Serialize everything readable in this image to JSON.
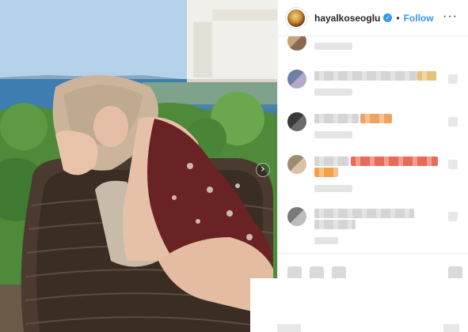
{
  "post": {
    "username": "hayalkoseoglu",
    "verified_glyph": "✓",
    "separator": "•",
    "follow_label": "Follow",
    "more_glyph": "···",
    "next_glyph": "›"
  },
  "colors": {
    "follow_blue": "#3897f0",
    "text_dark": "#262626",
    "border": "#efefef"
  },
  "comments": [
    {
      "avatar_colors": [
        "#c9a27e",
        "#8a6b52"
      ],
      "text_colors": [
        "#d0d0d0"
      ],
      "emoji_colors": []
    },
    {
      "avatar_colors": [
        "#6e7fa8",
        "#b5a9c8"
      ],
      "text_colors": [
        "#cfcfcf"
      ],
      "emoji_colors": [
        "#d9c9e8",
        "#e6c27a"
      ]
    },
    {
      "avatar_colors": [
        "#3a3a3a",
        "#6b6b6b"
      ],
      "text_colors": [
        "#cfcfcf"
      ],
      "emoji_colors": [
        "#f0a35e",
        "#e8c9a0"
      ]
    },
    {
      "avatar_colors": [
        "#a08a72",
        "#d9c2a5"
      ],
      "text_colors": [
        "#cfcfcf"
      ],
      "emoji_colors": [
        "#f4a04a",
        "#e86a5a",
        "#d94b4b"
      ]
    },
    {
      "avatar_colors": [
        "#7a7a7a",
        "#bdbdbd"
      ],
      "text_colors": [
        "#cfcfcf"
      ],
      "emoji_colors": []
    }
  ],
  "icons": [
    "heart-icon",
    "comment-icon",
    "share-icon",
    "bookmark-icon",
    "more-icon",
    "verified-icon",
    "next-arrow-icon"
  ]
}
